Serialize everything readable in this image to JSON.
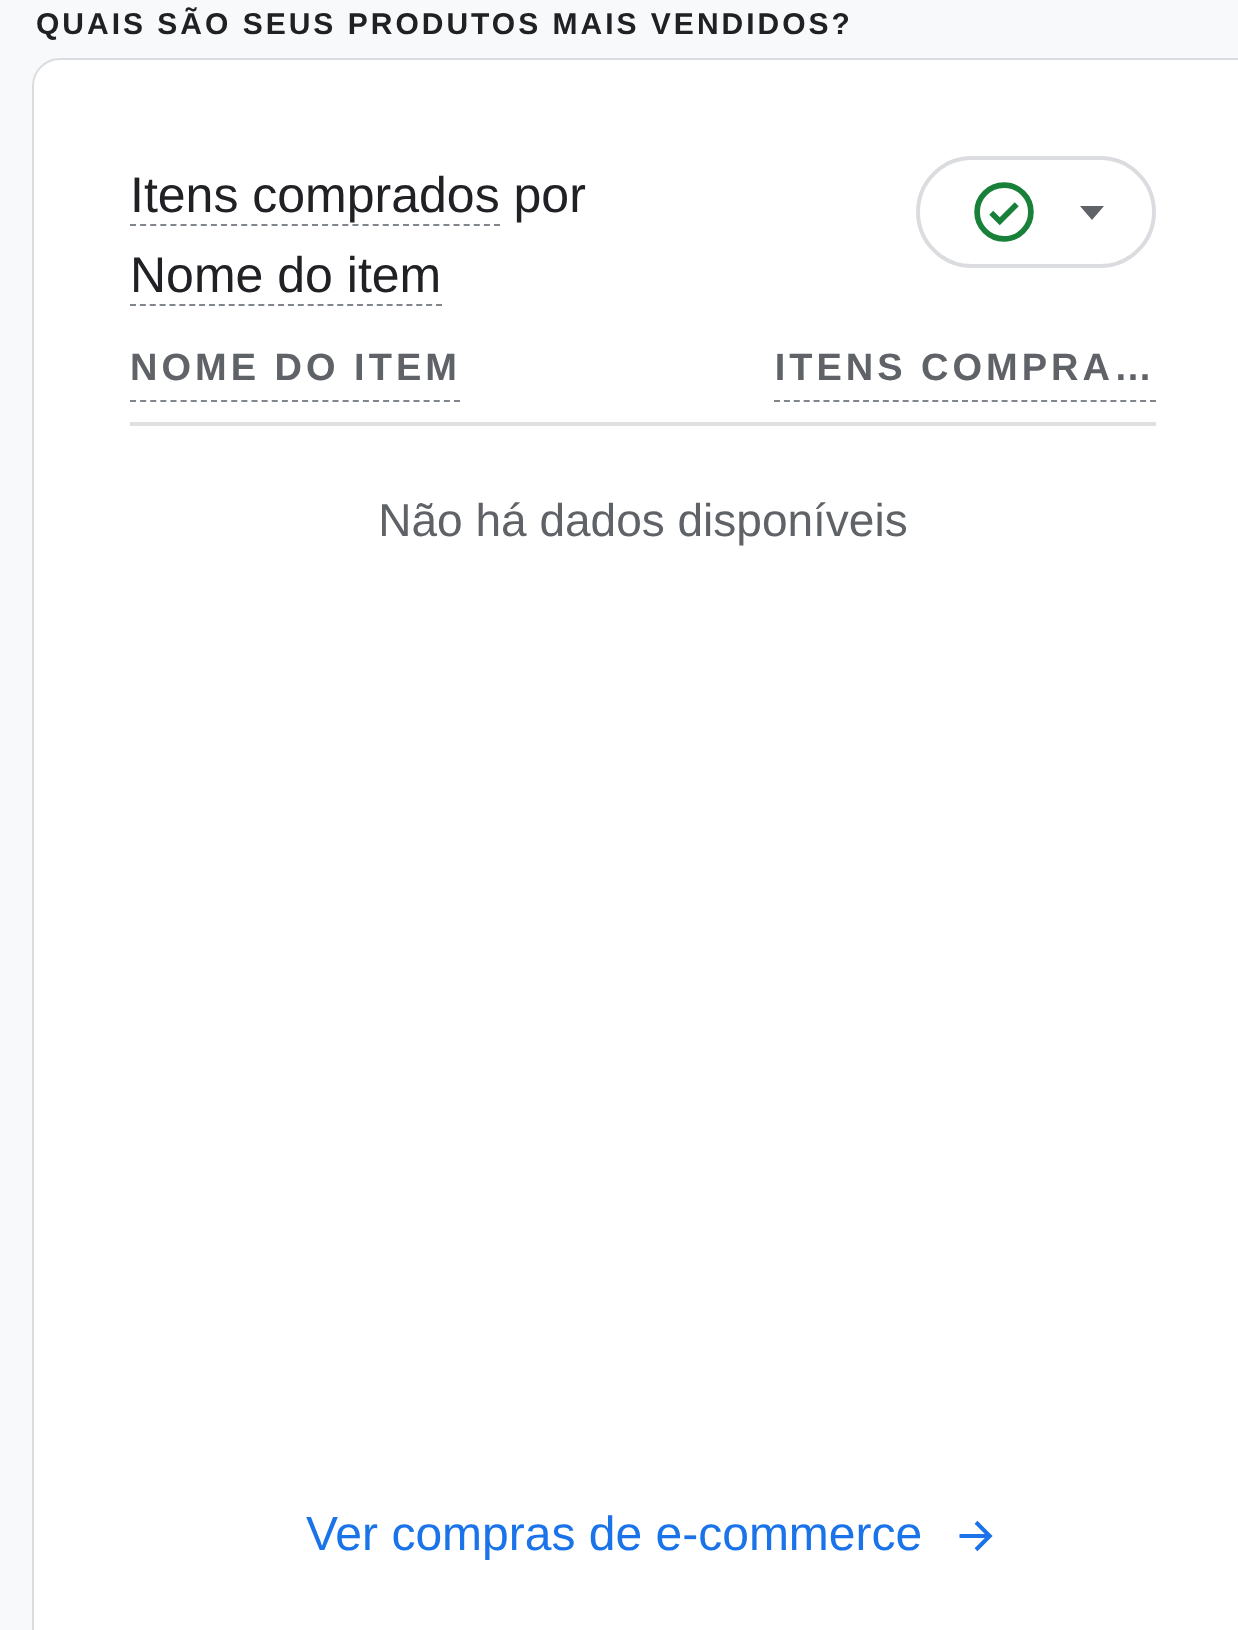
{
  "section_heading": "QUAIS SÃO SEUS PRODUTOS MAIS VENDIDOS?",
  "card": {
    "title": {
      "metric": "Itens comprados",
      "connector": "por",
      "dimension": "Nome do item"
    },
    "status_dropdown": {
      "valid": true
    },
    "table": {
      "columns": [
        "NOME DO ITEM",
        "ITENS COMPRA…"
      ],
      "empty_message": "Não há dados disponíveis"
    },
    "footer_link": "Ver compras de e-commerce"
  }
}
